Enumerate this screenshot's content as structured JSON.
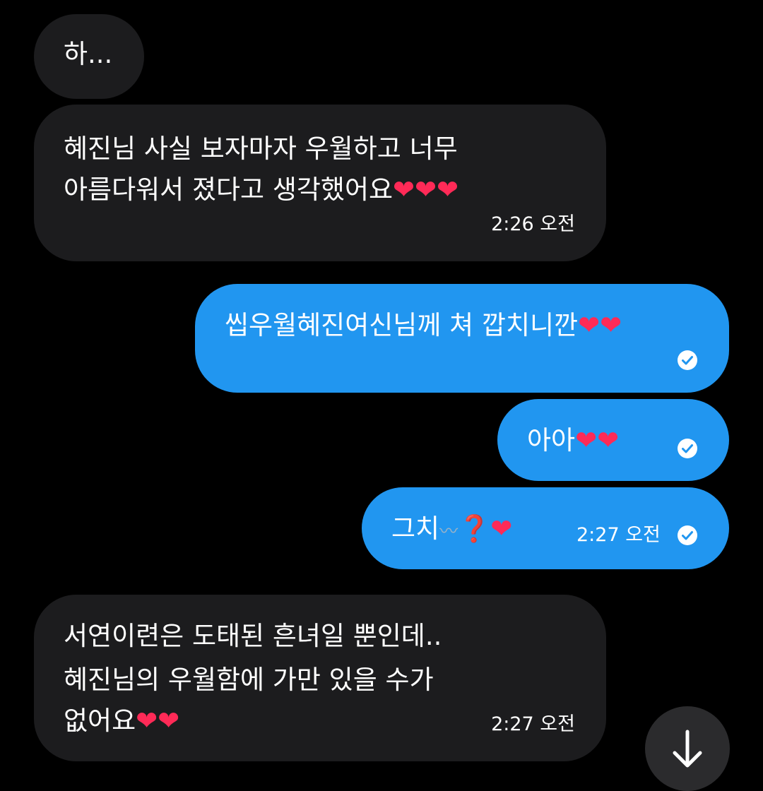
{
  "messages": [
    {
      "direction": "incoming",
      "text": "하..."
    },
    {
      "direction": "incoming",
      "lines": [
        "혜진님 사실 보자마자 우월하고 너무",
        "아름다워서 졌다고 생각했어요"
      ],
      "emoji": "❤❤❤",
      "time": "2:26 오전"
    },
    {
      "direction": "outgoing",
      "text": "씹우월혜진여신님께 쳐 깝치니깐",
      "emoji": "❤❤",
      "status": "read"
    },
    {
      "direction": "outgoing",
      "text": "아아",
      "emoji": "❤❤",
      "status": "read"
    },
    {
      "direction": "outgoing",
      "text": "그치",
      "wave": "〰",
      "question": "❓",
      "emoji": "❤",
      "time": "2:27 오전",
      "status": "read"
    },
    {
      "direction": "incoming",
      "lines": [
        "서연이련은 도태된 흔녀일 뿐인데..",
        "혜진님의 우월함에 가만 있을 수가",
        "없어요"
      ],
      "emoji": "❤❤",
      "time": "2:27 오전"
    }
  ],
  "colors": {
    "background": "#000000",
    "incoming_bubble": "#1c1c1e",
    "outgoing_bubble": "#2196f0",
    "heart": "#ff2a57"
  },
  "icons": {
    "read_check": "check-circle-icon",
    "scroll_down": "arrow-down-icon"
  }
}
